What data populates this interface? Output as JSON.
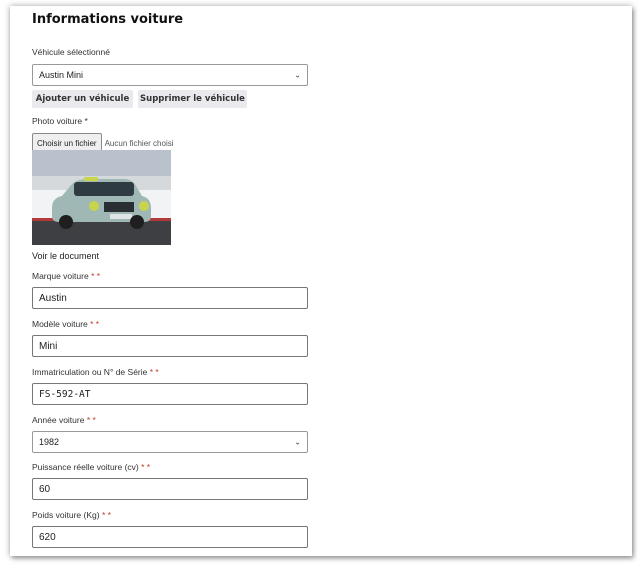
{
  "form": {
    "title": "Informations voiture",
    "vehicle_select": {
      "label": "Véhicule sélectionné",
      "value": "Austin Mini"
    },
    "buttons": {
      "add": "Ajouter un véhicule",
      "delete": "Supprimer le véhicule"
    },
    "photo": {
      "label": "Photo voiture",
      "required_mark": "*",
      "file_button": "Choisir un fichier",
      "file_status": "Aucun fichier choisi"
    },
    "view_document": "Voir le document",
    "fields": {
      "brand": {
        "label": "Marque voiture",
        "required_mark": "* *",
        "value": "Austin"
      },
      "model": {
        "label": "Modèle voiture",
        "required_mark": "* *",
        "value": "Mini"
      },
      "registration": {
        "label": "Immatriculation ou N° de Série",
        "required_mark": "* *",
        "value": "FS-592-AT"
      },
      "year": {
        "label": "Année voiture",
        "required_mark": "* *",
        "value": "1982"
      },
      "power": {
        "label": "Puissance réelle voiture (cv)",
        "required_mark": "* *",
        "value": "60"
      },
      "weight": {
        "label": "Poids voiture (Kg)",
        "required_mark": "* *",
        "value": "620"
      }
    }
  },
  "colors": {
    "required": "#c0392b",
    "button_bg": "#e9e9ee",
    "car_body": "#9fb7b5"
  },
  "icons": {
    "dropdown": "chevron-down-icon"
  }
}
